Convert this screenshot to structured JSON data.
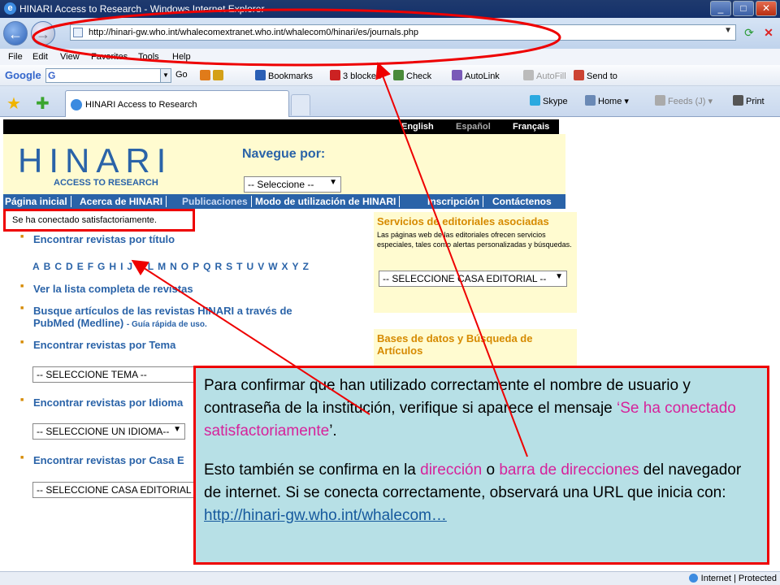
{
  "window": {
    "title": "HINARI Access to Research - Windows Internet Explorer",
    "minimize": "_",
    "maximize": "□",
    "close": "✕"
  },
  "address_bar": {
    "url": "http://hinari-gw.who.int/whalecomextranet.who.int/whalecom0/hinari/es/journals.php"
  },
  "menu": [
    "File",
    "Edit",
    "View",
    "Favorites",
    "Tools",
    "Help"
  ],
  "google_toolbar": {
    "logo": "Google",
    "go": "Go",
    "items": [
      "Bookmarks",
      "3 blocked",
      "Check",
      "AutoLink",
      "AutoFill",
      "Send to"
    ]
  },
  "tab": {
    "title": "HINARI Access to Research"
  },
  "command_bar": [
    "Skype",
    "Home",
    "Feeds (J)",
    "Print"
  ],
  "site": {
    "languages": [
      "English",
      "Español",
      "Français"
    ],
    "logo_main": "HINARI",
    "logo_sub": "ACCESS TO RESEARCH",
    "nav_label": "Navegue por:",
    "nav_select": "-- Seleccione --",
    "main_nav": [
      "Página inicial",
      "Acerca de HINARI",
      "Publicaciones",
      "Modo de utilización de HINARI",
      "Inscripción",
      "Contáctenos"
    ],
    "login_notice": "Se ha conectado satisfactoriamente.",
    "links": {
      "by_title": "Encontrar revistas por título",
      "full_list": "Ver la lista completa de revistas",
      "pubmed_1": "Busque artículos de las revistas HINARI a través de",
      "pubmed_2": "PubMed (Medline)",
      "pubmed_guide": "- Guía rápida de uso.",
      "by_topic": "Encontrar revistas por Tema",
      "by_language": "Encontrar revistas por Idioma",
      "by_publisher": "Encontrar revistas por Casa E"
    },
    "alphabet": [
      "A",
      "B",
      "C",
      "D",
      "E",
      "F",
      "G",
      "H",
      "I",
      "J",
      "K",
      "L",
      "M",
      "N",
      "O",
      "P",
      "Q",
      "R",
      "S",
      "T",
      "U",
      "V",
      "W",
      "X",
      "Y",
      "Z"
    ],
    "select_topic": "-- SELECCIONE TEMA --",
    "select_language": "-- SELECCIONE UN IDIOMA--",
    "select_publisher": "-- SELECCIONE CASA EDITORIAL",
    "right": {
      "publisher_title": "Servicios de editoriales asociadas",
      "publisher_desc": "Las páginas web de las editoriales ofrecen servicios especiales, tales como alertas personalizadas y búsquedas.",
      "publisher_select": "-- SELECCIONE CASA EDITORIAL --",
      "db_title_1": "Bases de datos y Búsqueda de",
      "db_title_2": "Artículos"
    }
  },
  "annotation": {
    "p1_a": "Para confirmar que han utilizado correctamente el nombre de usuario y contraseña de la institución, verifique si aparece el mensaje ",
    "p1_highlight": "‘Se ha conectado satisfactoriamente",
    "p1_b": "’.",
    "p2_a": "Esto también se confirma en la ",
    "p2_h1": "dirección",
    "p2_b": " o ",
    "p2_h2": "barra de direcciones",
    "p2_c": " del navegador de internet.  Si se conecta correctamente, observará una URL que inicia con:",
    "link": "http://hinari-gw.who.int/whalecom…"
  },
  "status_bar": {
    "zone": "Internet | Protected"
  },
  "colors": {
    "accent": "#2a63a8",
    "highlight": "#d6239b",
    "annotation_bg": "#b7e0e6",
    "callout_red": "#e00000"
  },
  "icons": [
    "back-arrow-icon",
    "forward-arrow-icon",
    "refresh-icon",
    "stop-icon",
    "star-icon",
    "add-favorite-icon",
    "home-icon",
    "feeds-icon",
    "print-icon",
    "skype-icon"
  ]
}
